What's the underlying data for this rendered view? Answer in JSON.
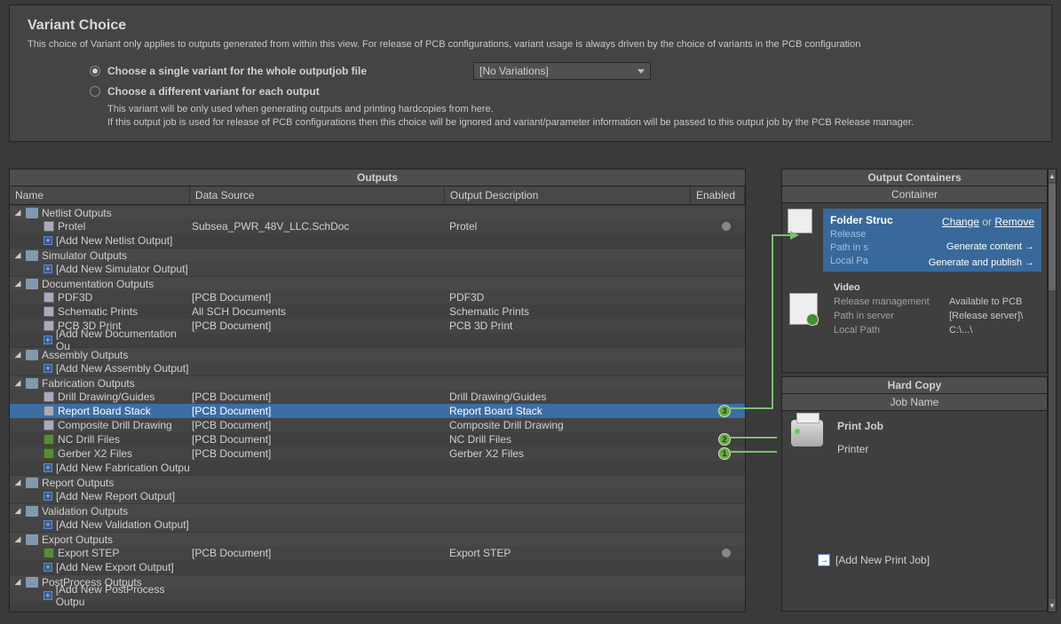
{
  "variant": {
    "title": "Variant Choice",
    "desc": "This choice of Variant only applies to outputs generated from within this view. For release of PCB configurations, variant usage is always driven by the choice of variants in the PCB configuration",
    "radio1": "Choose a single variant for the whole outputjob file",
    "radio2": "Choose a different variant for each output",
    "dropdown": "[No Variations]",
    "note1": "This variant will be only used when generating outputs and printing hardcopies from here.",
    "note2": "If this output job is used for release of PCB configurations then this choice will be ignored and variant/parameter information will be passed to this output job by the PCB Release manager."
  },
  "outputs": {
    "header": "Outputs",
    "cols": {
      "name": "Name",
      "ds": "Data Source",
      "od": "Output Description",
      "en": "Enabled"
    },
    "cats": [
      {
        "name": "Netlist Outputs",
        "items": [
          {
            "name": "Protel",
            "ds": "Subsea_PWR_48V_LLC.SchDoc",
            "od": "Protel",
            "dot": true
          },
          {
            "add": "[Add New Netlist Output]"
          }
        ]
      },
      {
        "name": "Simulator Outputs",
        "items": [
          {
            "add": "[Add New Simulator Output]"
          }
        ]
      },
      {
        "name": "Documentation Outputs",
        "items": [
          {
            "name": "PDF3D",
            "ds": "[PCB Document]",
            "od": "PDF3D"
          },
          {
            "name": "Schematic Prints",
            "ds": "All SCH Documents",
            "od": "Schematic Prints"
          },
          {
            "name": "PCB 3D Print",
            "ds": "[PCB Document]",
            "od": "PCB 3D Print"
          },
          {
            "add": "[Add New Documentation Ou"
          }
        ]
      },
      {
        "name": "Assembly Outputs",
        "items": [
          {
            "add": "[Add New Assembly Output]"
          }
        ]
      },
      {
        "name": "Fabrication Outputs",
        "items": [
          {
            "name": "Drill Drawing/Guides",
            "ds": "[PCB Document]",
            "od": "Drill Drawing/Guides"
          },
          {
            "name": "Report Board Stack",
            "ds": "[PCB Document]",
            "od": "Report Board Stack",
            "selected": true,
            "badge": "3"
          },
          {
            "name": "Composite Drill Drawing",
            "ds": "[PCB Document]",
            "od": "Composite Drill Drawing"
          },
          {
            "name": "NC Drill Files",
            "ds": "[PCB Document]",
            "od": "NC Drill Files",
            "green": true,
            "badge": "2"
          },
          {
            "name": "Gerber X2 Files",
            "ds": "[PCB Document]",
            "od": "Gerber X2 Files",
            "green": true,
            "badge": "1"
          },
          {
            "add": "[Add New Fabrication Outpu"
          }
        ]
      },
      {
        "name": "Report Outputs",
        "items": [
          {
            "add": "[Add New Report Output]"
          }
        ]
      },
      {
        "name": "Validation Outputs",
        "items": [
          {
            "add": "[Add New Validation Output]"
          }
        ]
      },
      {
        "name": "Export Outputs",
        "items": [
          {
            "name": "Export STEP",
            "ds": "[PCB Document]",
            "od": "Export STEP",
            "green": true,
            "dot": true
          },
          {
            "add": "[Add New Export Output]"
          }
        ]
      },
      {
        "name": "PostProcess Outputs",
        "items": [
          {
            "add": "[Add New PostProcess Outpu"
          }
        ]
      }
    ]
  },
  "containers": {
    "header": "Output Containers",
    "sub": "Container",
    "folder": {
      "title": "Folder Struc",
      "labels": [
        "Release",
        "Path in s",
        "Local Pa"
      ],
      "change": "Change",
      "or": "or",
      "remove": "Remove",
      "gen1": "Generate content",
      "gen2": "Generate and publish"
    },
    "video": {
      "title": "Video",
      "rows": [
        {
          "label": "Release management",
          "val": "Available to PCB"
        },
        {
          "label": "Path in server",
          "val": "[Release server]\\"
        },
        {
          "label": "Local Path",
          "val": "C:\\...\\"
        }
      ]
    }
  },
  "hardcopy": {
    "header": "Hard Copy",
    "sub": "Job Name",
    "title": "Print Job",
    "printer": "Printer",
    "add": "[Add New Print Job]"
  }
}
